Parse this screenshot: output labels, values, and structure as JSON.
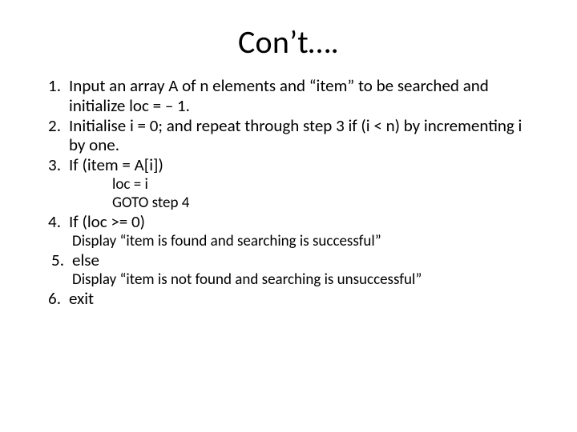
{
  "title": "Con’t….",
  "items": {
    "n1": "1.",
    "t1": "Input an array A of n elements and “item” to be searched and initialize loc = – 1.",
    "n2": "2.",
    "t2": "Initialise i = 0; and repeat through step 3 if (i < n) by incrementing i by one.",
    "n3": "3.",
    "t3": "If (item = A[i])",
    "sub3a": "loc = i",
    "sub3b": "GOTO step 4",
    "n4": "4.",
    "t4": "If (loc >= 0)",
    "sub4": "Display “item is found and searching is successful”",
    "n5": "5.",
    "t5": "else",
    "sub5": "Display “item is not found and searching is unsuccessful”",
    "n6": "6.",
    "t6": " exit"
  }
}
